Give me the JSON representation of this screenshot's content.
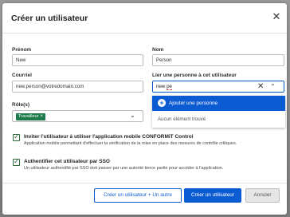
{
  "dialog": {
    "title": "Créer un utilisateur",
    "close_icon": "close-icon"
  },
  "form": {
    "first_name": {
      "label": "Prénom",
      "value": "New"
    },
    "last_name": {
      "label": "Nom",
      "value": "Person"
    },
    "email": {
      "label": "Courriel",
      "value": "new.person@votredomain.com"
    },
    "link_person": {
      "label": "Lier une personne à cet utilisateur",
      "value_prefix": "new ",
      "value_typed": "pe",
      "clear_icon": "close-icon",
      "caret_icon": "chevron-up-icon"
    },
    "dropdown": {
      "add_option": "Ajouter une personne",
      "add_icon": "plus-circle-icon",
      "empty_text": "Aucun élément trouvé"
    },
    "roles": {
      "label": "Rôle(s)",
      "tags": [
        "Travailleur"
      ],
      "caret_icon": "chevron-down-icon"
    },
    "invite_mobile": {
      "checked": true,
      "title": "Inviter l'utilisateur à utiliser l'application mobile CONFORMiT Control",
      "description": "Application mobile permettant d'effectuer la vérification de la mise en place des mesures de contrôle critiques."
    },
    "sso": {
      "checked": true,
      "title": "Authentifier cet utilisateur par SSO",
      "description": "Un utilisateur authentifié par SSO doit passer par une autorité tierce partie pour accéder à l'application."
    }
  },
  "footer": {
    "create_another": "Créer un utilisateur + Un autre",
    "create": "Créer un utilisateur",
    "cancel": "Annuler"
  },
  "colors": {
    "primary": "#0b5bd3",
    "tag_green": "#1e7a4c"
  }
}
